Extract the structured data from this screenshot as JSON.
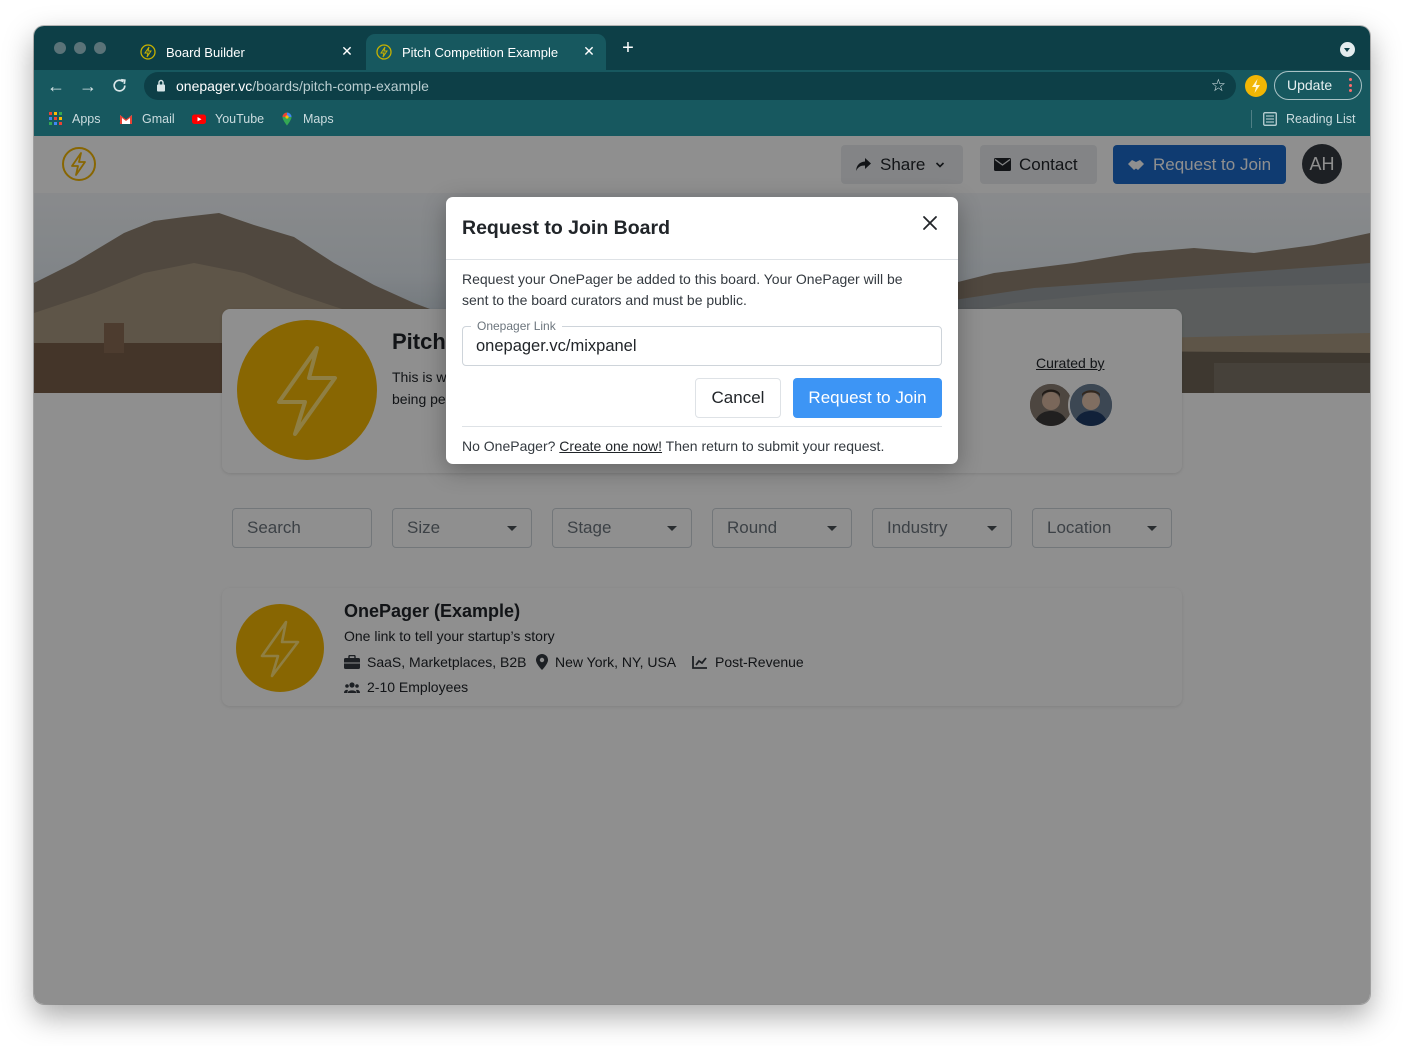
{
  "browser": {
    "tabs": [
      {
        "title": "Board Builder",
        "active": false
      },
      {
        "title": "Pitch Competition Example",
        "active": true
      }
    ],
    "url_host": "onepager.vc",
    "url_path": "/boards/pitch-comp-example",
    "update_label": "Update",
    "bookmarks": [
      "Apps",
      "Gmail",
      "YouTube",
      "Maps"
    ],
    "reading_list": "Reading List"
  },
  "site_nav": {
    "share_label": "Share",
    "contact_label": "Contact",
    "join_label": "Request to Join",
    "avatar_initials": "AH"
  },
  "board": {
    "title_fragment": "Pitch",
    "desc_line1_fragment": "This is w",
    "desc_line2_fragment": "being pe",
    "curated_by_label": "Curated by"
  },
  "filters": {
    "search_placeholder": "Search",
    "selects": [
      "Size",
      "Stage",
      "Round",
      "Industry",
      "Location"
    ]
  },
  "listing": {
    "name": "OnePager (Example)",
    "tagline": "One link to tell your startup’s story",
    "industries": "SaaS, Marketplaces, B2B",
    "location": "New York, NY, USA",
    "stage": "Post-Revenue",
    "employees": "2-10 Employees"
  },
  "modal": {
    "title": "Request to Join Board",
    "text_line1": "Request your OnePager be added to this board. Your OnePager will be",
    "text_line2": "sent to the board curators and must be public.",
    "field_label": "Onepager Link",
    "field_value": "onepager.vc/mixpanel",
    "cancel_label": "Cancel",
    "submit_label": "Request to Join",
    "footer_prefix": "No OnePager?",
    "footer_link": "Create one now!",
    "footer_suffix": "Then return to submit your request."
  },
  "colors": {
    "brand_yellow": "#f2b604",
    "chrome_dark": "#0d3f47",
    "chrome_teal": "#17585f",
    "primary_blue": "#3d95f5",
    "nav_blue": "#1b6ac9"
  }
}
